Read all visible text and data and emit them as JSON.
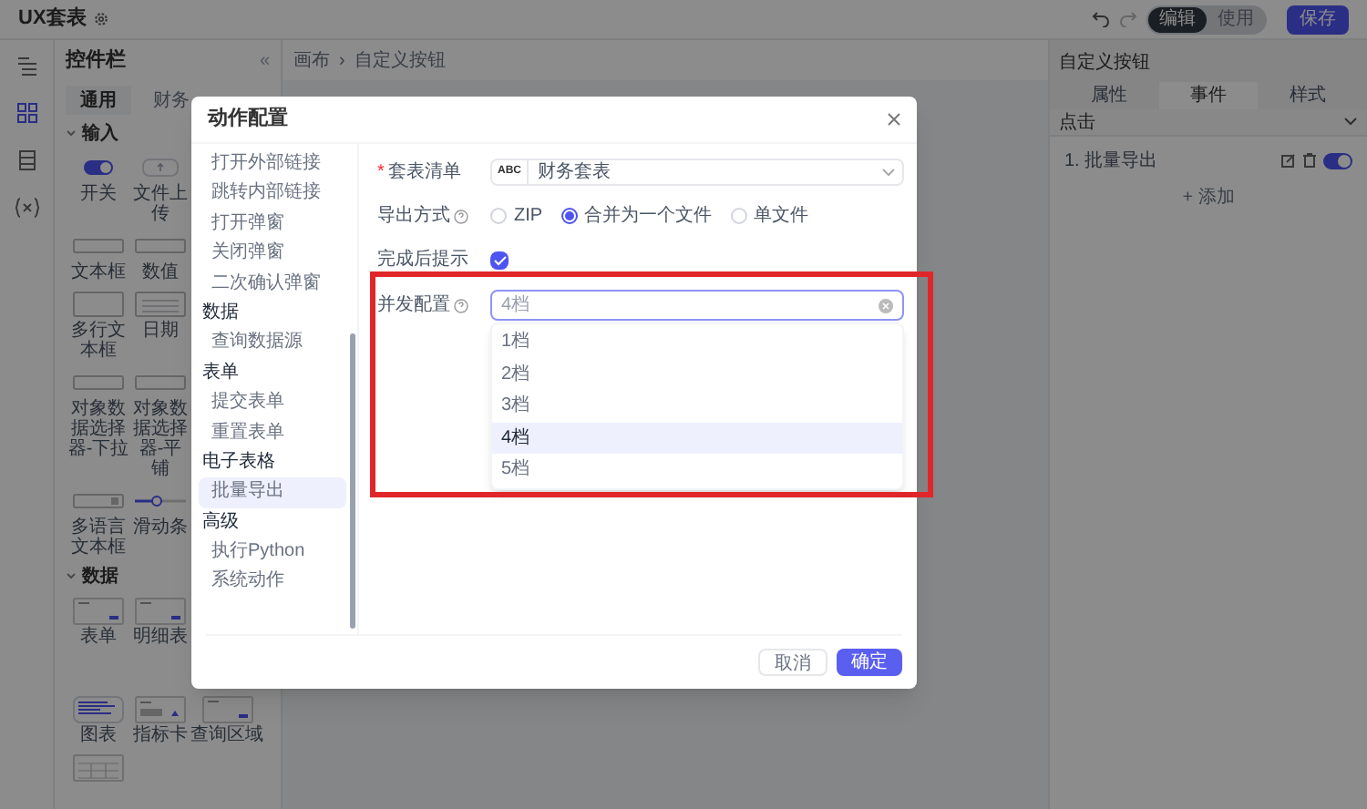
{
  "app": {
    "title": "UX套表",
    "mode_toggle": [
      {
        "label": "编辑",
        "selected": true
      },
      {
        "label": "使用",
        "selected": false
      }
    ],
    "save": "保存"
  },
  "controls_panel": {
    "title": "控件栏",
    "collapse": "«",
    "tabs": [
      {
        "label": "通用",
        "selected": true
      },
      {
        "label": "财务",
        "selected": false
      }
    ],
    "sections": [
      {
        "title": "输入",
        "expanded": true,
        "rows": [
          [
            {
              "label": "开关",
              "kind": "switch"
            },
            {
              "label": "文件上传",
              "kind": "upload"
            }
          ],
          [
            {
              "label": "文本框",
              "kind": "textbox"
            },
            {
              "label": "数值",
              "kind": "number"
            }
          ],
          [
            {
              "label": "多行文本框",
              "kind": "textarea"
            },
            {
              "label": "日期",
              "kind": "date"
            }
          ],
          [
            {
              "label": "对象数据选择器-下拉",
              "kind": "textbox"
            },
            {
              "label": "对象数据选择器-平铺",
              "kind": "textbox"
            }
          ],
          [
            {
              "label": "多语言文本框",
              "kind": "multilang"
            },
            {
              "label": "滑动条",
              "kind": "slider"
            }
          ]
        ]
      },
      {
        "title": "数据",
        "expanded": true,
        "rows": [
          [
            {
              "label": "表单",
              "kind": "form"
            },
            {
              "label": "明细表",
              "kind": "form"
            }
          ],
          [
            {
              "label": "图表",
              "kind": "chart"
            },
            {
              "label": "指标卡",
              "kind": "kpi"
            },
            {
              "label": "查询区域",
              "kind": "form"
            }
          ],
          [
            {
              "kind": "grid"
            }
          ]
        ]
      }
    ]
  },
  "breadcrumb": {
    "items": [
      "画布",
      "自定义按钮"
    ],
    "separator": "›"
  },
  "inspector": {
    "title": "自定义按钮",
    "tabs": [
      {
        "label": "属性",
        "selected": false
      },
      {
        "label": "事件",
        "selected": true
      },
      {
        "label": "样式",
        "selected": false
      }
    ],
    "event": {
      "name": "点击",
      "expanded": true,
      "actions": [
        {
          "label": "1. 批量导出",
          "on": true
        }
      ],
      "add": "+ 添加"
    }
  },
  "dialog": {
    "title": "动作配置",
    "action_list": [
      {
        "kind": "item",
        "label": "打开外部链接",
        "selected": false
      },
      {
        "kind": "item",
        "label": "跳转内部链接",
        "selected": false
      },
      {
        "kind": "item",
        "label": "打开弹窗",
        "selected": false
      },
      {
        "kind": "item",
        "label": "关闭弹窗",
        "selected": false
      },
      {
        "kind": "item",
        "label": "二次确认弹窗",
        "selected": false
      },
      {
        "kind": "group",
        "label": "数据"
      },
      {
        "kind": "item",
        "label": "查询数据源",
        "selected": false
      },
      {
        "kind": "group",
        "label": "表单"
      },
      {
        "kind": "item",
        "label": "提交表单",
        "selected": false
      },
      {
        "kind": "item",
        "label": "重置表单",
        "selected": false
      },
      {
        "kind": "group",
        "label": "电子表格"
      },
      {
        "kind": "item",
        "label": "批量导出",
        "selected": true
      },
      {
        "kind": "group",
        "label": "高级"
      },
      {
        "kind": "item",
        "label": "执行Python",
        "selected": false
      },
      {
        "kind": "item",
        "label": "系统动作",
        "selected": false
      }
    ],
    "form": {
      "workbook": {
        "label": "套表清单",
        "required_mark": "*",
        "badge": "ABC",
        "value": "财务套表"
      },
      "export_mode": {
        "label": "导出方式",
        "options": [
          {
            "label": "ZIP",
            "selected": false
          },
          {
            "label": "合并为一个文件",
            "selected": true
          },
          {
            "label": "单文件",
            "selected": false
          }
        ]
      },
      "notify": {
        "label": "完成后提示",
        "checked": true
      },
      "concurrency": {
        "label": "并发配置",
        "value": "4档",
        "options": [
          {
            "label": "1档",
            "selected": false
          },
          {
            "label": "2档",
            "selected": false
          },
          {
            "label": "3档",
            "selected": false
          },
          {
            "label": "4档",
            "selected": true
          },
          {
            "label": "5档",
            "selected": false
          }
        ]
      }
    },
    "buttons": {
      "cancel": "取消",
      "ok": "确定"
    }
  }
}
